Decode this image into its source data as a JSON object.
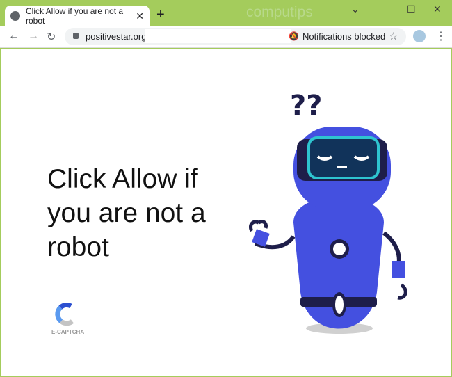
{
  "browser": {
    "tab_title": "Click Allow if you are not a robot",
    "watermark": "computips",
    "url": "positivestar.org/",
    "notification_status": "Notifications blocked",
    "icons": [
      "globe-icon",
      "close-icon",
      "new-tab-icon",
      "back-icon",
      "forward-icon",
      "reload-icon",
      "lock-icon",
      "bell-off-icon",
      "star-icon",
      "avatar",
      "menu-icon"
    ]
  },
  "page": {
    "headline": "Click Allow if you are not a robot",
    "captcha_label": "E-CAPTCHA"
  },
  "colors": {
    "frame": "#a4cc5c",
    "robot": "#4450e0",
    "visor": "#2ec4d0"
  }
}
